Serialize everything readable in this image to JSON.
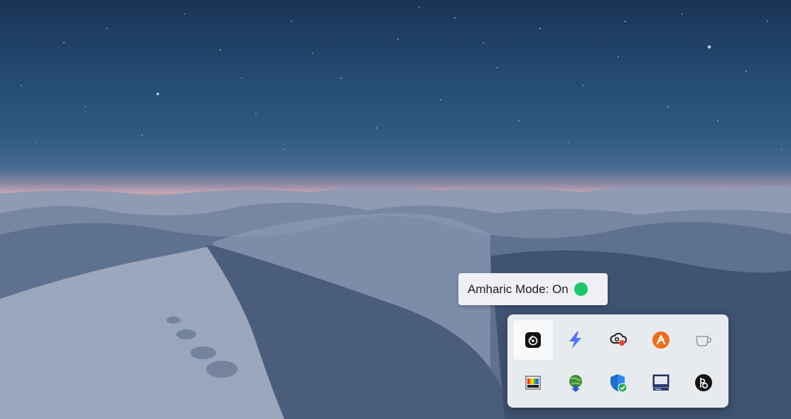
{
  "tooltip": {
    "label": "Amharic Mode: On",
    "status_color": "#1ec96b"
  },
  "tray_icons": [
    {
      "icon": "obs-studio-icon",
      "active": true
    },
    {
      "icon": "lightning-bolt-app-icon",
      "active": false
    },
    {
      "icon": "creative-cloud-sync-icon",
      "active": false
    },
    {
      "icon": "avast-antivirus-icon",
      "active": false
    },
    {
      "icon": "coffee-cup-icon",
      "active": false
    },
    {
      "icon": "color-palette-icon",
      "active": false
    },
    {
      "icon": "download-manager-globe-icon",
      "active": false
    },
    {
      "icon": "windows-security-shield-icon",
      "active": false
    },
    {
      "icon": "display-monitor-icon",
      "active": false
    },
    {
      "icon": "beats-b-icon",
      "active": false
    }
  ]
}
